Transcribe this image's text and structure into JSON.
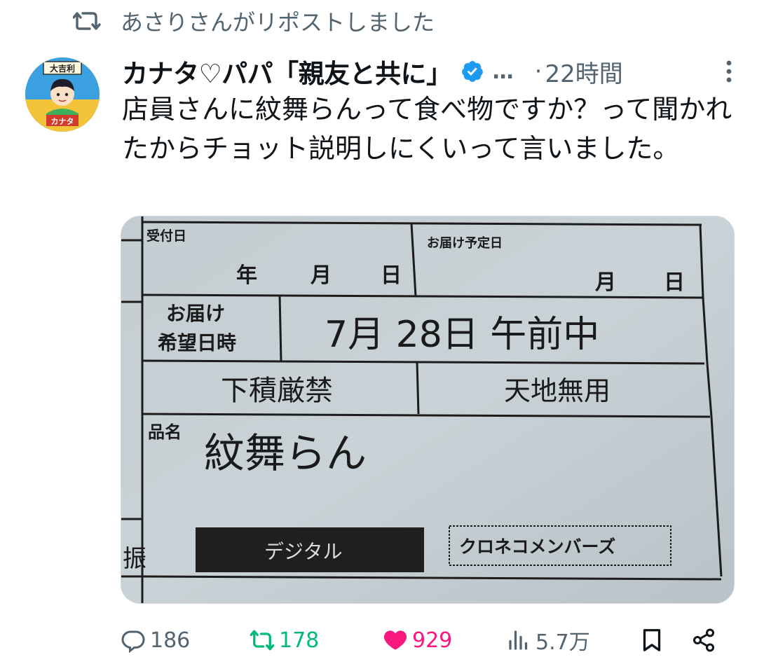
{
  "repost": {
    "icon": "repost-icon",
    "label": "あさりさんがリポストしました"
  },
  "author": {
    "name": "カナタ♡パパ「親友と共に」",
    "verified": true,
    "more_name": "…",
    "separator": "·",
    "time": "22時間",
    "avatar_text_top": "大吉利",
    "avatar_text_bottom": "カナタ"
  },
  "tweet": {
    "text": "店員さんに紋舞らんって食べ物ですか？って聞かれたからチョット説明しにくいって言いました。"
  },
  "media": {
    "label_receipt_date": "受付日",
    "year": "年",
    "month": "月",
    "day": "日",
    "label_delivery_date": "お届け予定日",
    "label_request_line1": "お届け",
    "label_request_line2": "希望日時",
    "request_value": "7月 28日 午前中",
    "no_stacking": "下積厳禁",
    "this_side": "天地無用",
    "label_item": "品名",
    "item_name": "紋舞らん",
    "digital": "デジタル",
    "member": "クロネコメンバーズ",
    "side_char": "振"
  },
  "actions": {
    "replies": "186",
    "reposts": "178",
    "likes": "929",
    "views": "5.7万"
  },
  "colors": {
    "secondary": "#536471",
    "repost_green": "#00ba7c",
    "like_pink": "#f91880",
    "verified_blue": "#1d9bf0"
  }
}
